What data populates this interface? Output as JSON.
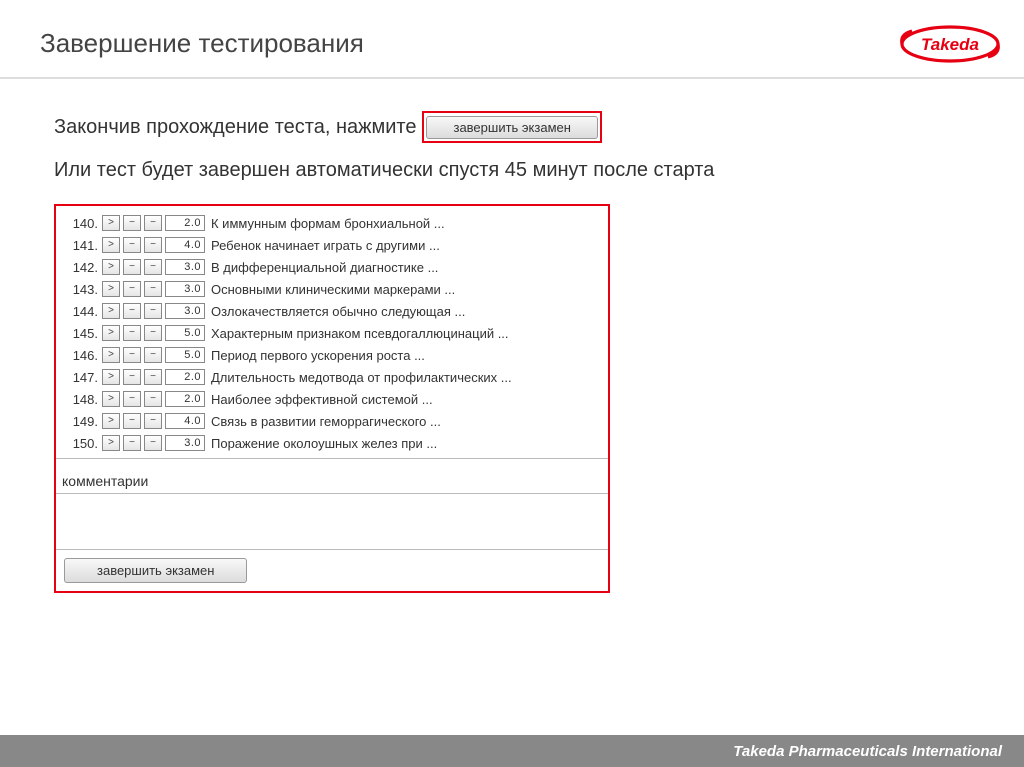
{
  "header": {
    "title": "Завершение тестирования"
  },
  "brand": {
    "name": "Takeda"
  },
  "instructions": {
    "line1_prefix": "Закончив прохождение теста, нажмите",
    "finish_button_label": "завершить экзамен",
    "line2": "Или тест будет завершен автоматически спустя 45 минут после старта"
  },
  "questions": [
    {
      "num": "140.",
      "val": "2.0",
      "text": "К иммунным формам бронхиальной ..."
    },
    {
      "num": "141.",
      "val": "4.0",
      "text": "Ребенок начинает играть с другими ..."
    },
    {
      "num": "142.",
      "val": "3.0",
      "text": "В дифференциальной диагностике ..."
    },
    {
      "num": "143.",
      "val": "3.0",
      "text": "Основными клиническими маркерами ..."
    },
    {
      "num": "144.",
      "val": "3.0",
      "text": "Озлокачествляется обычно следующая ..."
    },
    {
      "num": "145.",
      "val": "5.0",
      "text": "Характерным признаком псевдогаллюцинаций ..."
    },
    {
      "num": "146.",
      "val": "5.0",
      "text": "Период первого ускорения роста ..."
    },
    {
      "num": "147.",
      "val": "2.0",
      "text": "Длительность медотвода от профилактических ..."
    },
    {
      "num": "148.",
      "val": "2.0",
      "text": "Наиболее эффективной системой ..."
    },
    {
      "num": "149.",
      "val": "4.0",
      "text": "Связь в развитии геморрагического ..."
    },
    {
      "num": "150.",
      "val": "3.0",
      "text": "Поражение околоушных желез при ..."
    }
  ],
  "panel": {
    "comments_label": "комментарии",
    "finish_button_label": "завершить экзамен"
  },
  "footer": {
    "text": "Takeda Pharmaceuticals International"
  },
  "glyphs": {
    "chevron": ">",
    "minus": "−"
  }
}
